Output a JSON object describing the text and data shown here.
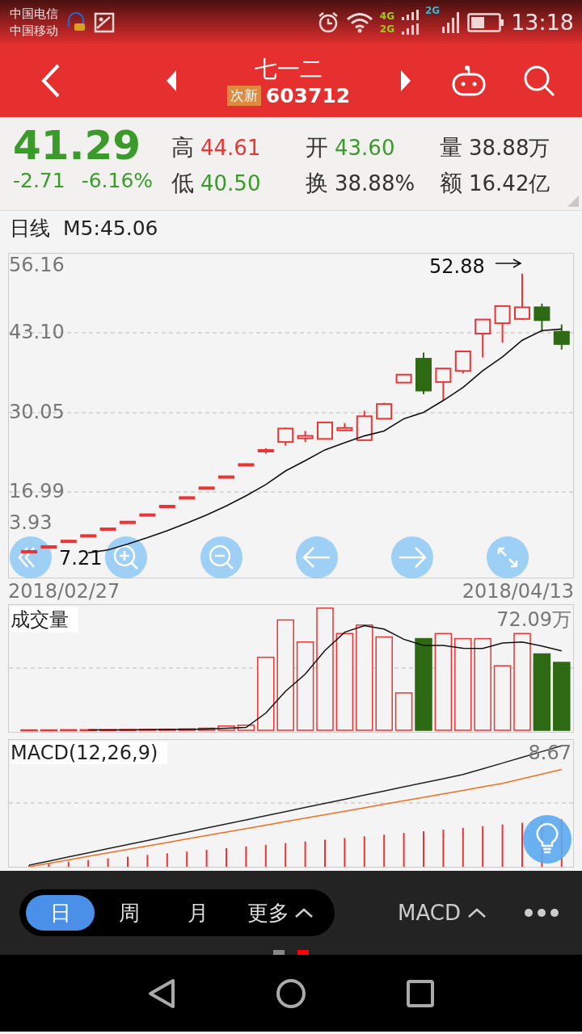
{
  "status_bar": {
    "carriers": [
      "中国电信",
      "中国移动"
    ],
    "network_top": "4G",
    "network_bottom": "2G",
    "network_second": "2G",
    "time": "13:18"
  },
  "header": {
    "title": "七一二",
    "tag": "次新",
    "code": "603712"
  },
  "quote": {
    "price": "41.29",
    "change": "-2.71",
    "change_pct": "-6.16%",
    "stats": [
      {
        "label": "高",
        "value": "44.61",
        "color": "#e83535"
      },
      {
        "label": "开",
        "value": "43.60",
        "color": "#3a9a2a"
      },
      {
        "label": "量",
        "value": "38.88万",
        "color": "#333333"
      },
      {
        "label": "低",
        "value": "40.50",
        "color": "#3a9a2a"
      },
      {
        "label": "换",
        "value": "38.88%",
        "color": "#333333"
      },
      {
        "label": "额",
        "value": "16.42亿",
        "color": "#333333"
      }
    ]
  },
  "chart": {
    "period": "日线",
    "ma": "M5:45.06",
    "y_ticks": [
      "56.16",
      "43.10",
      "30.05",
      "16.99",
      "3.93"
    ],
    "max_label": "52.88",
    "min_label": "7.21",
    "start_date": "2018/02/27",
    "end_date": "2018/04/13"
  },
  "volume": {
    "title": "成交量",
    "max": "72.09万"
  },
  "macd": {
    "title": "MACD(12,26,9)",
    "value": "8.67"
  },
  "toolbar": {
    "periods": [
      {
        "label": "日",
        "selected": true,
        "kind": "period"
      },
      {
        "label": "周",
        "selected": false,
        "kind": "period"
      },
      {
        "label": "月",
        "selected": false,
        "kind": "period"
      },
      {
        "label": "更多",
        "selected": false,
        "kind": "menu"
      }
    ],
    "indicator": "MACD"
  },
  "page_indicator": [
    {
      "selected": false
    },
    {
      "selected": true
    }
  ]
}
